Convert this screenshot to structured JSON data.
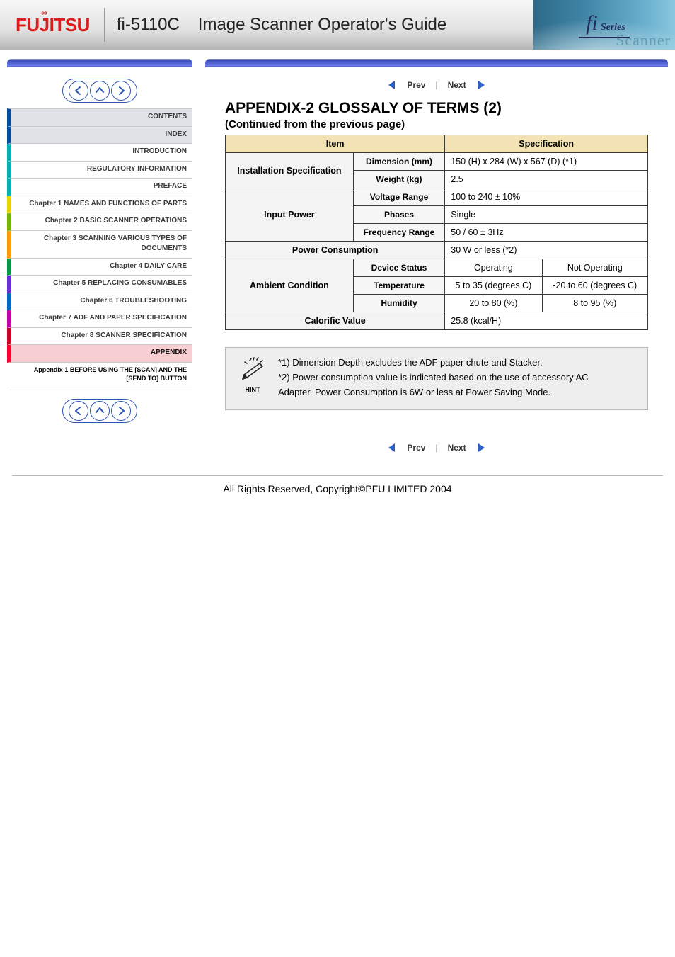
{
  "header": {
    "logo_text": "FUJITSU",
    "model": "fi-5110C",
    "title": "Image Scanner Operator's Guide",
    "fi": "fi",
    "series": "Series",
    "scanner_script": "Scanner"
  },
  "sidebar": {
    "items": [
      {
        "label": "CONTENTS",
        "cls": "p-idx"
      },
      {
        "label": "INDEX",
        "cls": "p-idx"
      },
      {
        "label": "INTRODUCTION",
        "cls": "p-pref"
      },
      {
        "label": "REGULATORY INFORMATION",
        "cls": "p-pref"
      },
      {
        "label": "PREFACE",
        "cls": "p-pref"
      },
      {
        "label": "Chapter 1 NAMES AND FUNCTIONS OF PARTS",
        "cls": "p-1"
      },
      {
        "label": "Chapter 2 BASIC SCANNER OPERATIONS",
        "cls": "p-2"
      },
      {
        "label": "Chapter 3 SCANNING VARIOUS TYPES OF DOCUMENTS",
        "cls": "p-3"
      },
      {
        "label": "Chapter 4 DAILY CARE",
        "cls": "p-4"
      },
      {
        "label": "Chapter 5 REPLACING CONSUMABLES",
        "cls": "p-5"
      },
      {
        "label": "Chapter 6 TROUBLESHOOTING",
        "cls": "p-6"
      },
      {
        "label": "Chapter 7 ADF AND PAPER SPECIFICATION",
        "cls": "p-7"
      },
      {
        "label": "Chapter 8 SCANNER SPECIFICATION",
        "cls": "p-8"
      },
      {
        "label": "APPENDIX",
        "cls": "p-app active"
      }
    ],
    "sub": {
      "label": "Appendix 1 BEFORE USING THE [SCAN] AND THE [SEND TO] BUTTON"
    }
  },
  "crumbs": {
    "prev": "Prev",
    "next": "Next"
  },
  "appendix": {
    "title": "APPENDIX-2 GLOSSALY OF TERMS (2)",
    "subtitle": "(Continued from the previous page)"
  },
  "table": {
    "h1": "Item",
    "h2": "Specification",
    "rows": [
      {
        "k": "Installation Specification",
        "vcols": [
          "Dimension (mm)",
          "Weight (kg)"
        ],
        "v": [
          "150 (H) x 284 (W) x 567 (D) (*1)",
          "2.5"
        ]
      },
      {
        "k": "Input Power",
        "vcols": [
          "Voltage Range",
          "Phases",
          "Frequency Range"
        ],
        "v": [
          "100 to 240 ± 10%",
          "Single",
          "50 / 60 ± 3Hz"
        ]
      },
      {
        "k": "Power Consumption",
        "v": "30 W or less (*2)"
      },
      {
        "group": "Ambient Condition",
        "rows": [
          {
            "k": "Device Status",
            "v": [
              "Operating",
              "Not Operating"
            ]
          },
          {
            "k": "Temperature",
            "v": [
              "5 to 35 (degrees C)",
              "-20 to 60 (degrees C)"
            ]
          },
          {
            "k": "Humidity",
            "v": [
              "20 to 80 (%)",
              "8 to 95 (%)"
            ]
          }
        ]
      },
      {
        "k": "Calorific Value",
        "v": "25.8 (kcal/H)"
      }
    ]
  },
  "notes": {
    "hint": "HINT",
    "n1": "*1) Dimension Depth excludes the ADF paper chute and Stacker.",
    "n2": "*2) Power consumption value is indicated based on the use of accessory AC",
    "n2b": "     Adapter.  Power Consumption is 6W or less at Power Saving Mode."
  },
  "footer": {
    "copyright": "All Rights Reserved, Copyright©PFU LIMITED 2004"
  },
  "icons": {
    "left_label": "prev-icon",
    "up_label": "up-icon",
    "right_label": "next-icon"
  }
}
